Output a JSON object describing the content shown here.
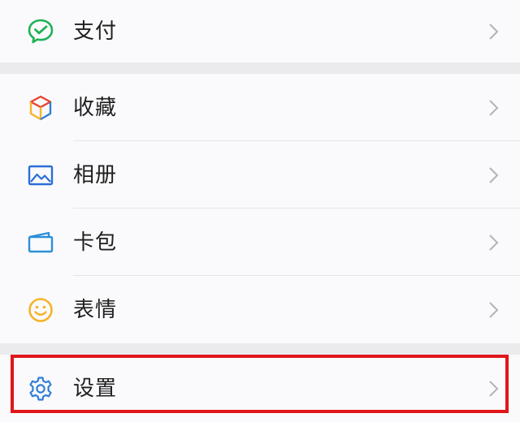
{
  "menu": {
    "pay": {
      "label": "支付",
      "icon": "wechat-pay-icon",
      "accent": "#1fb256"
    },
    "favorites": {
      "label": "收藏",
      "icon": "cube-icon"
    },
    "album": {
      "label": "相册",
      "icon": "photo-album-icon",
      "accent": "#2b6ed8"
    },
    "cards": {
      "label": "卡包",
      "icon": "wallet-card-icon",
      "accent": "#2b8fd8"
    },
    "stickers": {
      "label": "表情",
      "icon": "smiley-icon",
      "accent": "#f5b32a"
    },
    "settings": {
      "label": "设置",
      "icon": "gear-icon",
      "accent": "#2f7fd6"
    }
  },
  "highlight": {
    "target": "settings",
    "color": "#e0161b"
  }
}
